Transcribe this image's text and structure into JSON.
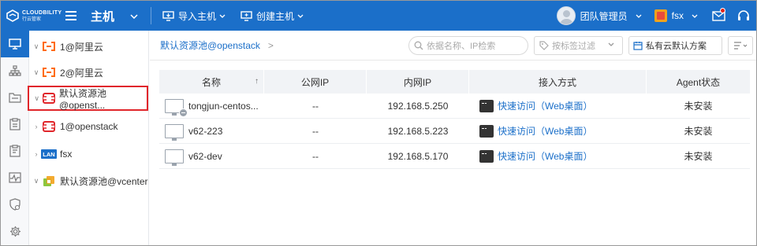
{
  "header": {
    "logo_line1": "CLOUDBILITY",
    "logo_line2": "行云管家",
    "title": "主机",
    "import_label": "导入主机",
    "create_label": "创建主机",
    "user_name": "团队管理员",
    "org_name": "fsx",
    "colors": {
      "bar": "#1b6fc9",
      "badge": "#e2231a"
    }
  },
  "sidenav": {
    "items": [
      "monitor-icon",
      "topology-icon",
      "folder-icon",
      "clipboard-icon",
      "document-icon",
      "chart-icon",
      "shield-icon",
      "gear-icon"
    ]
  },
  "tree": {
    "items": [
      {
        "label": "1@阿里云",
        "icon": "aliyun-icon"
      },
      {
        "label": "2@阿里云",
        "icon": "aliyun-icon"
      },
      {
        "label": "默认资源池@openst...",
        "icon": "openstack-icon"
      },
      {
        "label": "1@openstack",
        "icon": "openstack-icon"
      },
      {
        "label": "fsx",
        "icon": "lan-icon",
        "badge": "LAN"
      },
      {
        "label": "默认资源池@vcenter",
        "icon": "vcenter-icon"
      }
    ]
  },
  "toolbar": {
    "breadcrumb": "默认资源池@openstack",
    "breadcrumb_sep": ">",
    "search_placeholder": "依据名称、IP检索",
    "tag_placeholder": "按标签过滤",
    "plan_label": "私有云默认方案"
  },
  "table": {
    "headers": [
      "名称",
      "公网IP",
      "内网IP",
      "接入方式",
      "Agent状态"
    ],
    "sort_indicator": "↑",
    "rows": [
      {
        "name": "tongjun-centos...",
        "public_ip": "--",
        "private_ip": "192.168.5.250",
        "access": "快速访问（Web桌面）",
        "agent": "未安装",
        "stopped": true
      },
      {
        "name": "v62-223",
        "public_ip": "--",
        "private_ip": "192.168.5.223",
        "access": "快速访问（Web桌面）",
        "agent": "未安装",
        "stopped": false
      },
      {
        "name": "v62-dev",
        "public_ip": "--",
        "private_ip": "192.168.5.170",
        "access": "快速访问（Web桌面）",
        "agent": "未安装",
        "stopped": false
      }
    ]
  }
}
